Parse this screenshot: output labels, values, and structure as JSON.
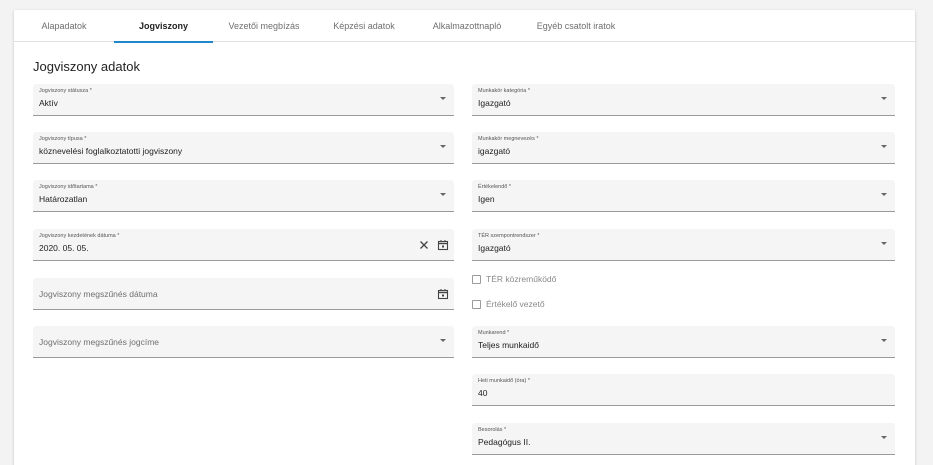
{
  "tabs": [
    {
      "label": "Alapadatok"
    },
    {
      "label": "Jogviszony"
    },
    {
      "label": "Vezetői megbízás"
    },
    {
      "label": "Képzési adatok"
    },
    {
      "label": "Alkalmazottnapló"
    },
    {
      "label": "Egyéb csatolt iratok"
    }
  ],
  "section": {
    "title": "Jogviszony adatok"
  },
  "left": {
    "status": {
      "label": "Jogviszony státusza *",
      "value": "Aktív"
    },
    "type": {
      "label": "Jogviszony típusa *",
      "value": "köznevelési foglalkoztatotti jogviszony"
    },
    "duration": {
      "label": "Jogviszony időtartama *",
      "value": "Határozatlan"
    },
    "start_date": {
      "label": "Jogviszony kezdetének dátuma *",
      "value": "2020. 05. 05."
    },
    "end_date": {
      "placeholder": "Jogviszony megszűnés dátuma"
    },
    "end_reason": {
      "placeholder": "Jogviszony megszűnés jogcíme"
    }
  },
  "right": {
    "job_category": {
      "label": "Munkakör kategória *",
      "value": "Igazgató"
    },
    "job_title": {
      "label": "Munkakör megnevezés *",
      "value": "igazgató"
    },
    "evaluated": {
      "label": "Értékelendő *",
      "value": "Igen"
    },
    "ter_system": {
      "label": "TÉR szempontrendszer *",
      "value": "Igazgató"
    },
    "ter_contributor": {
      "label": "TÉR közreműködő",
      "checked": false
    },
    "evaluating_leader": {
      "label": "Értékelő vezető",
      "checked": false
    },
    "work_schedule": {
      "label": "Munkarend *",
      "value": "Teljes munkaidő"
    },
    "weekly_hours": {
      "label": "Heti munkaidő (óra) *",
      "value": "40"
    },
    "classification": {
      "label": "Besorolás *",
      "value": "Pedagógus II."
    }
  },
  "colors": {
    "accent": "#1e88c8",
    "field_bg": "#f5f5f5",
    "underline": "#9a9a9a"
  }
}
